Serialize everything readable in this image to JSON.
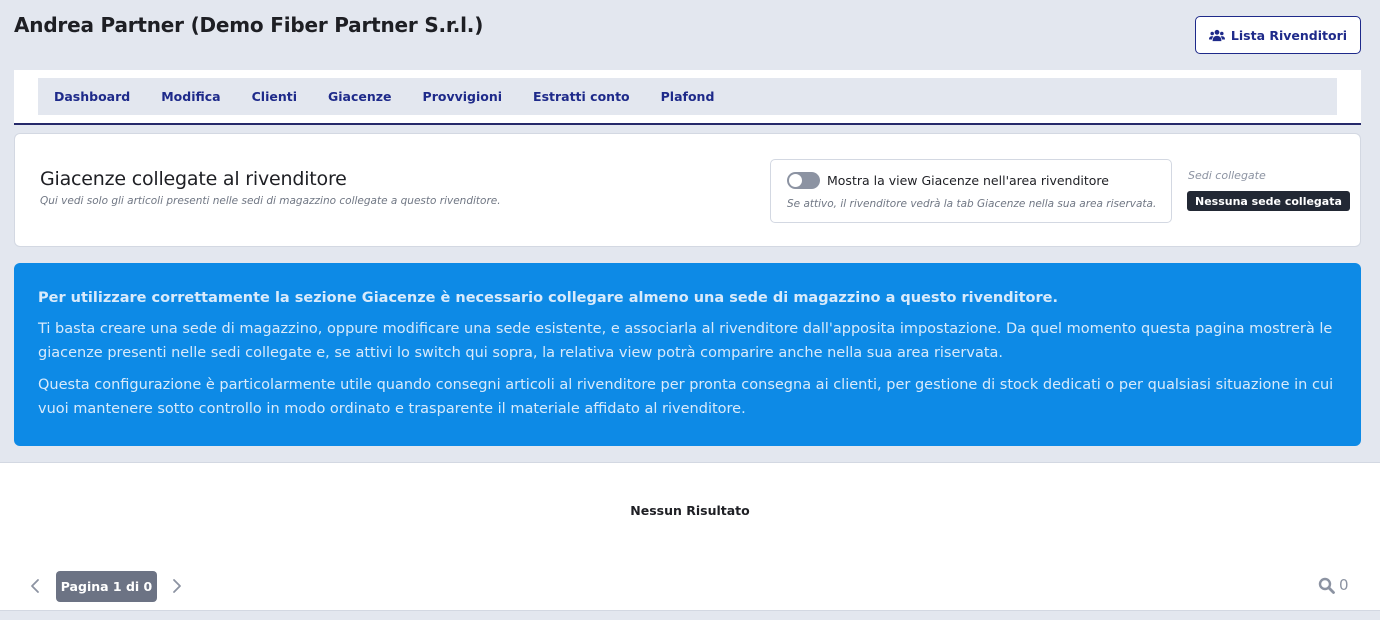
{
  "header": {
    "title": "Andrea Partner (Demo Fiber Partner S.r.l.)",
    "list_button_label": "Lista Rivenditori",
    "list_button_icon": "users-icon"
  },
  "nav": {
    "items": [
      {
        "label": "Dashboard"
      },
      {
        "label": "Modifica"
      },
      {
        "label": "Clienti"
      },
      {
        "label": "Giacenze"
      },
      {
        "label": "Provvigioni"
      },
      {
        "label": "Estratti conto"
      },
      {
        "label": "Plafond"
      }
    ]
  },
  "card": {
    "title": "Giacenze collegate al rivenditore",
    "subtitle": "Qui vedi solo gli articoli presenti nelle sedi di magazzino collegate a questo rivenditore.",
    "toggle": {
      "label": "Mostra la view Giacenze nell'area rivenditore",
      "hint": "Se attivo, il rivenditore vedrà la tab Giacenze nella sua area riservata.",
      "enabled": false
    },
    "sedi_label": "Sedi collegate",
    "sedi_badge": "Nessuna sede collegata"
  },
  "alert": {
    "heading": "Per utilizzare correttamente la sezione Giacenze è necessario collegare almeno una sede di magazzino a questo rivenditore.",
    "paragraph1": "Ti basta creare una sede di magazzino, oppure modificare una sede esistente, e associarla al rivenditore dall'apposita impostazione. Da quel momento questa pagina mostrerà le giacenze presenti nelle sedi collegate e, se attivi lo switch qui sopra, la relativa view potrà comparire anche nella sua area riservata.",
    "paragraph2": "Questa configurazione è particolarmente utile quando consegni articoli al rivenditore per pronta consegna ai clienti, per gestione di stock dedicati o per qualsiasi situazione in cui vuoi mantenere sotto controllo in modo ordinato e trasparente il materiale affidato al rivenditore."
  },
  "results": {
    "empty_message": "Nessun Risultato",
    "page_label": "Pagina 1 di 0",
    "search_count": "0"
  },
  "colors": {
    "accent": "#1e2a8a",
    "alert_bg": "#0d8ae6",
    "badge_bg": "#222834",
    "page_bg": "#e3e7ef"
  }
}
